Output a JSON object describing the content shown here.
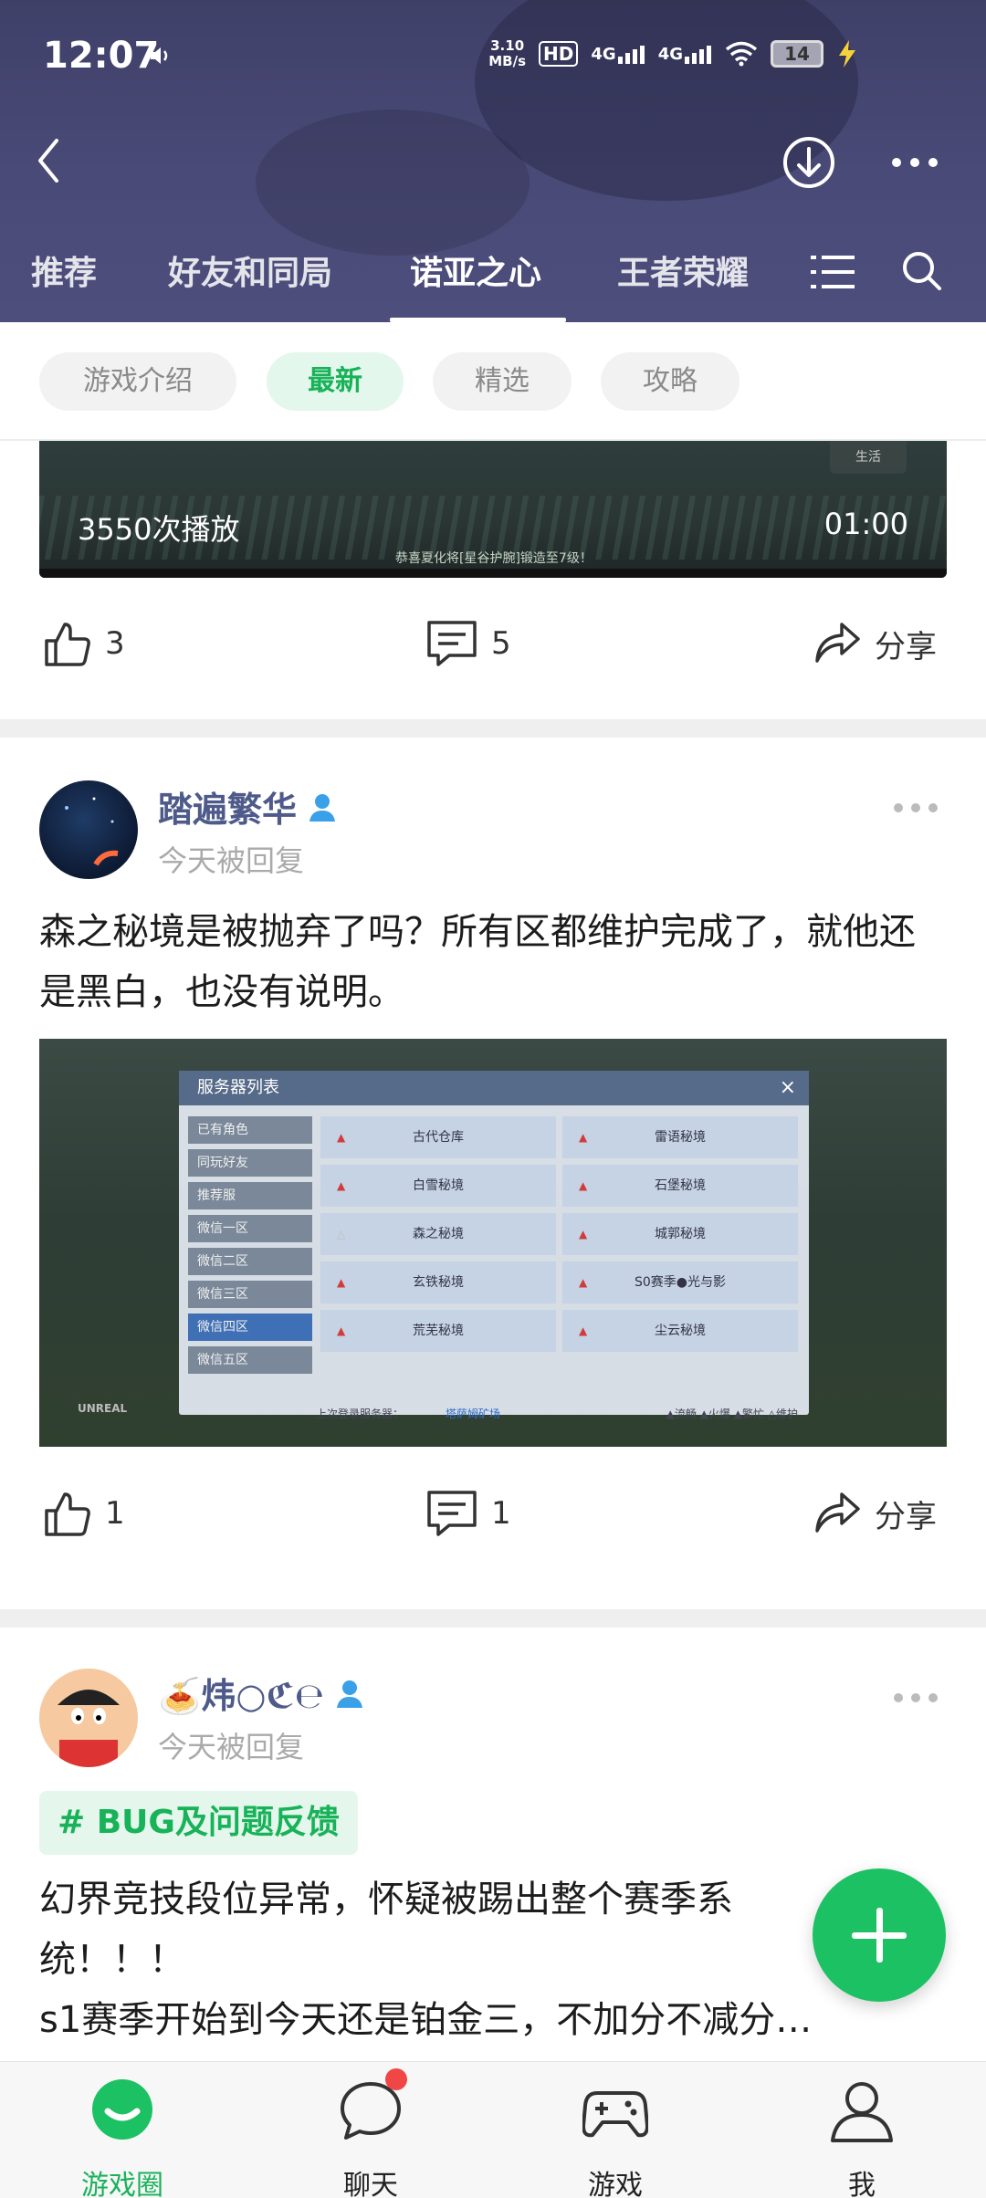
{
  "status_bar": {
    "time": "12:07",
    "net_speed_value": "3.10",
    "net_speed_unit": "MB/s",
    "hd": "HD",
    "signal1": "4G",
    "signal2": "4G",
    "battery": "14"
  },
  "top_tabs": [
    {
      "label": "推荐"
    },
    {
      "label": "好友和同局"
    },
    {
      "label": "诺亚之心"
    },
    {
      "label": "王者荣耀"
    }
  ],
  "filter_chips": [
    {
      "label": "游戏介绍"
    },
    {
      "label": "最新"
    },
    {
      "label": "精选"
    },
    {
      "label": "攻略"
    }
  ],
  "video_post": {
    "plays": "3550次播放",
    "duration": "01:00",
    "subtitle": "恭喜夏化将[星谷护腕]锻造至7级！",
    "corner": "生活",
    "likes": "3",
    "comments": "5",
    "share": "分享"
  },
  "post1": {
    "username": "踏遍繁华",
    "time": "今天被回复",
    "text": "森之秘境是被抛弃了吗？所有区都维护完成了，就他还是黑白，也没有说明。",
    "likes": "1",
    "comments": "1",
    "share": "分享",
    "screenshot": {
      "title": "服务器列表",
      "close": "×",
      "sidebar": [
        "已有角色",
        "同玩好友",
        "推荐服",
        "微信一区",
        "微信二区",
        "微信三区",
        "微信四区",
        "微信五区"
      ],
      "servers": [
        "古代仓库",
        "雷语秘境",
        "白雪秘境",
        "石堡秘境",
        "森之秘境",
        "城郭秘境",
        "玄铁秘境",
        "S0赛季●光与影",
        "荒芜秘境",
        "尘云秘境"
      ],
      "last_login_label": "上次登录服务器：",
      "last_login_value": "塔萨姆矿场",
      "legend": "▲流畅 ▲火爆 ▲繁忙 △维护",
      "engine": "UNREAL"
    }
  },
  "post2": {
    "username": "🍝炜○ℭ℮",
    "time": "今天被回复",
    "tag": "# BUG及问题反馈",
    "text_line1": "幻界竞技段位异常，怀疑被踢出整个赛季系",
    "text_line2": "统！！！",
    "text_line3": "s1赛季开始到今天还是铂金三，不加分不减分…"
  },
  "bottom_nav": [
    {
      "label": "游戏圈",
      "icon": "game-circle-icon"
    },
    {
      "label": "聊天",
      "icon": "chat-icon"
    },
    {
      "label": "游戏",
      "icon": "gamepad-icon"
    },
    {
      "label": "我",
      "icon": "profile-icon"
    }
  ],
  "colors": {
    "header_bg": "#4a4a78",
    "accent_green": "#18b259",
    "fab": "#1cc163",
    "username": "#4e5b8a",
    "badge": "#f04646"
  }
}
